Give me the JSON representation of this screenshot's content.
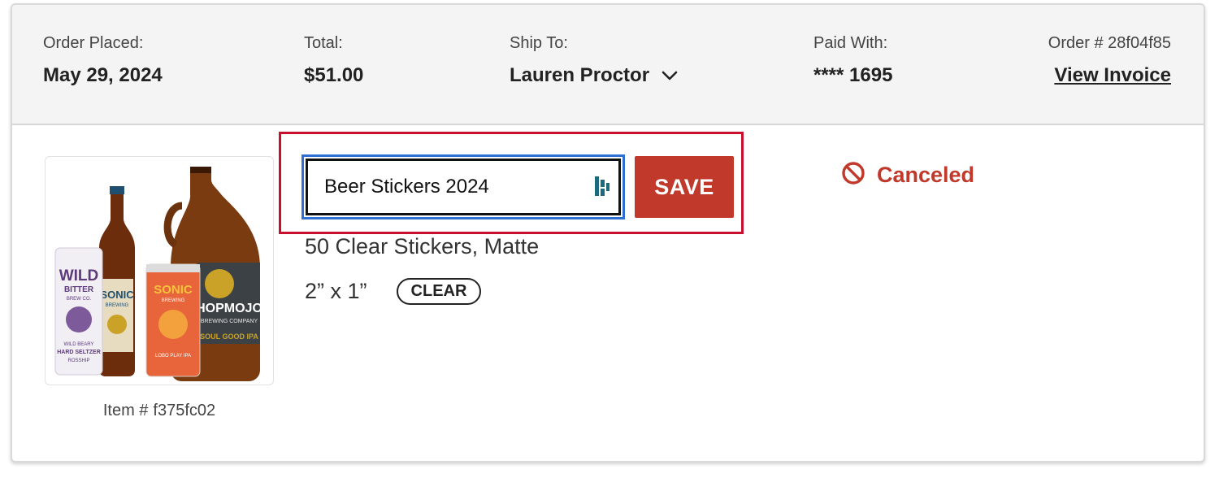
{
  "order": {
    "placed_label": "Order Placed:",
    "placed_value": "May 29, 2024",
    "total_label": "Total:",
    "total_value": "$51.00",
    "ship_to_label": "Ship To:",
    "ship_to_value": "Lauren Proctor",
    "paid_with_label": "Paid With:",
    "paid_with_value": "**** 1695",
    "order_number": "Order # 28f04f85",
    "view_invoice_label": "View Invoice"
  },
  "item": {
    "name_input_value": "Beer Stickers 2024",
    "save_label": "SAVE",
    "description": "50 Clear Stickers, Matte",
    "size": "2” x 1”",
    "finish_badge": "CLEAR",
    "item_number_label": "Item #",
    "item_number_value": "f375fc02",
    "status": "Canceled",
    "image_text": {
      "can1_line1": "WILD",
      "can1_line2": "BITTER",
      "can1_line3": "BREW CO.",
      "can1_line4": "WILD BEARY",
      "can1_line5": "HARD SELTZER",
      "can1_line6": "ROSSHIP",
      "bottle_brand": "SONIC",
      "bottle_sub": "BREWING",
      "can2_brand": "SONIC",
      "can2_sub": "BREWING",
      "can2_bottom": "LOBO PLAY IPA",
      "growler_brand": "HOPMOJO",
      "growler_sub": "BREWING COMPANY",
      "growler_bottom": "SOUL GOOD IPA"
    }
  },
  "icons": {
    "chevron": "chevron-down-icon",
    "input_extension": "password-manager-icon",
    "status": "prohibited-icon",
    "status_color": "#c0392b",
    "accent_color": "#c0392b",
    "focus_color": "#2e6fd3"
  }
}
